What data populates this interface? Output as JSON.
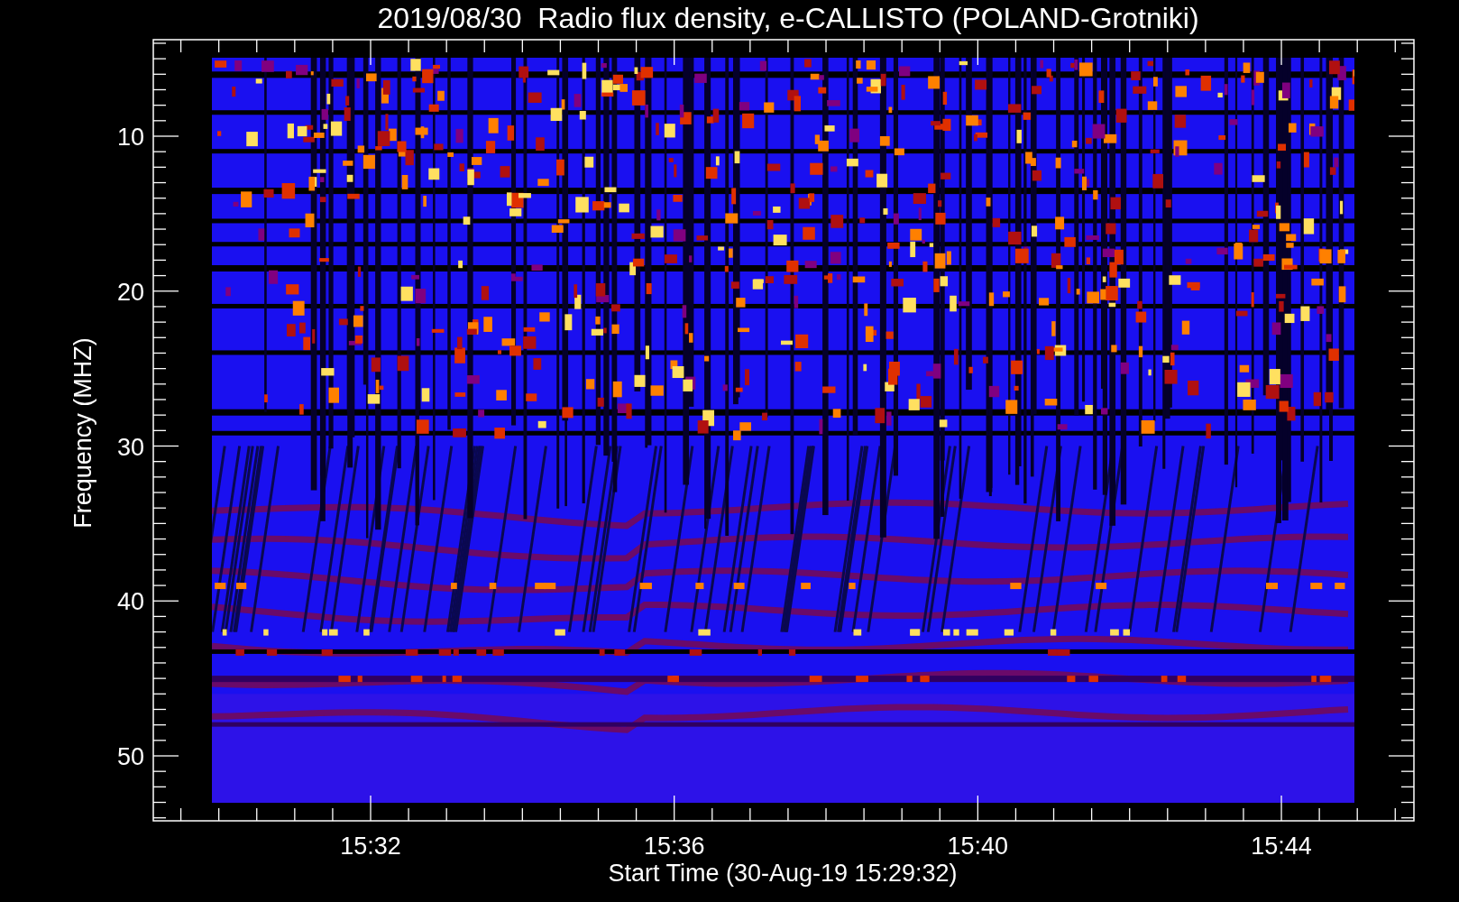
{
  "title": "2019/08/30  Radio flux density, e-CALLISTO (POLAND-Grotniki)",
  "y_axis": {
    "label": "Frequency (MHZ)",
    "ticks": [
      "10",
      "20",
      "30",
      "40",
      "50"
    ]
  },
  "x_axis": {
    "label": "Start Time (30-Aug-19 15:29:32)",
    "ticks": [
      "15:32",
      "15:36",
      "15:40",
      "15:44"
    ]
  }
}
